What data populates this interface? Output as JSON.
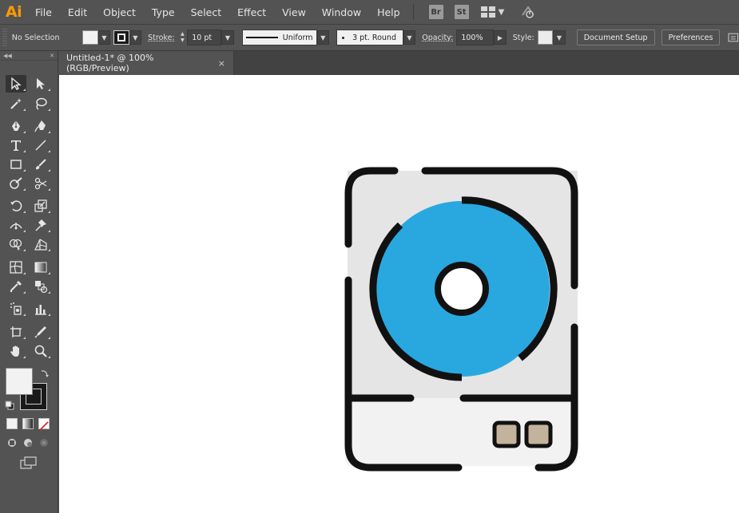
{
  "app": {
    "logo": "Ai",
    "accent": "#ff9a00"
  },
  "menu": {
    "items": [
      "File",
      "Edit",
      "Object",
      "Type",
      "Select",
      "Effect",
      "View",
      "Window",
      "Help"
    ],
    "bridge_label": "Br",
    "stock_label": "St"
  },
  "control_bar": {
    "selection_status": "No Selection",
    "stroke_label": "Stroke:",
    "stroke_weight": "10 pt",
    "stroke_profile": "Uniform",
    "brush": "3 pt. Round",
    "opacity_label": "Opacity:",
    "opacity_value": "100%",
    "style_label": "Style:",
    "document_setup": "Document Setup",
    "preferences": "Preferences"
  },
  "document": {
    "tab_title": "Untitled-1* @ 100% (RGB/Preview)",
    "close_glyph": "×"
  },
  "tools": [
    "selection-tool",
    "direct-selection-tool",
    "magic-wand-tool",
    "lasso-tool",
    "pen-tool",
    "curvature-tool",
    "type-tool",
    "line-segment-tool",
    "rectangle-tool",
    "paintbrush-tool",
    "shaper-tool",
    "scissors-tool",
    "rotate-tool",
    "scale-tool",
    "width-tool",
    "puppet-warp-tool",
    "shape-builder-tool",
    "perspective-grid-tool",
    "mesh-tool",
    "gradient-tool",
    "eyedropper-tool",
    "blend-tool",
    "symbol-sprayer-tool",
    "column-graph-tool",
    "artboard-tool",
    "slice-tool",
    "hand-tool",
    "zoom-tool"
  ],
  "colors": {
    "fill": "#f2f2f2",
    "stroke": "#111111",
    "device_body": "#e5e5e5",
    "device_bottom": "#f2f2f2",
    "disc": "#29a8e0",
    "button": "#c4b39c"
  }
}
